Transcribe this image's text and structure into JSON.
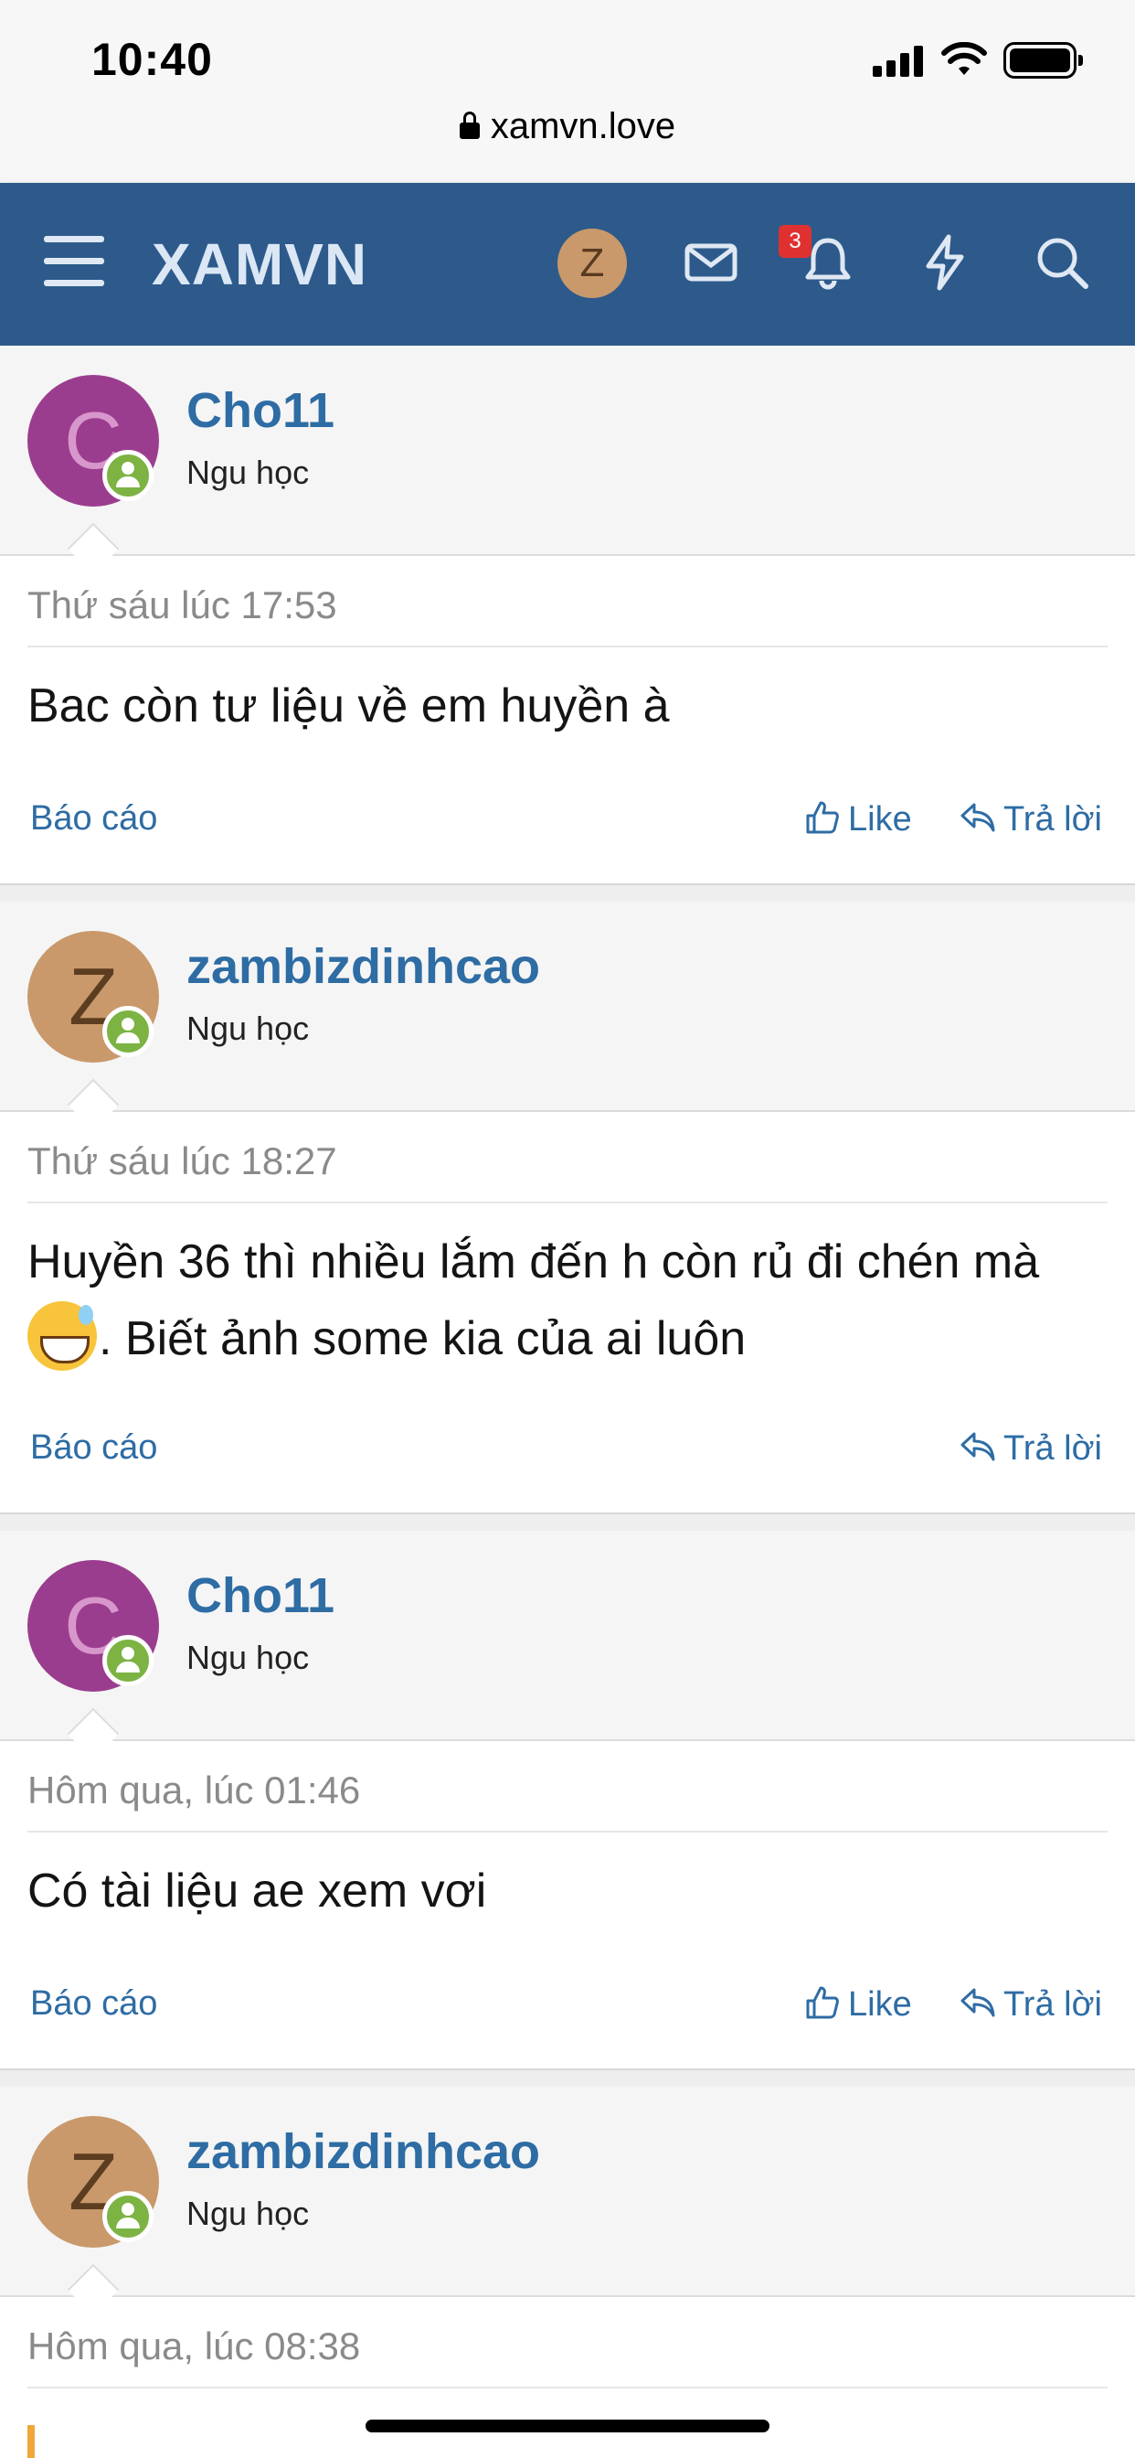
{
  "status_bar": {
    "time": "10:40",
    "url": "xamvn.love"
  },
  "nav": {
    "logo": "XAMVN",
    "avatar_letter": "Z",
    "notification_count": "3"
  },
  "posts": [
    {
      "username": "Cho11",
      "avatar_letter": "C",
      "user_title": "Ngu học",
      "date": "Thứ sáu lúc 17:53",
      "body": "Bac còn tư liệu về em huyền à",
      "report": "Báo cáo",
      "like": "Like",
      "reply": "Trả lời"
    },
    {
      "username": "zambizdinhcao",
      "avatar_letter": "Z",
      "user_title": "Ngu học",
      "date": "Thứ sáu lúc 18:27",
      "body_part1": "Huyền 36 thì nhiều lắm đến h còn rủ đi chén mà",
      "body_part2": ". Biết ảnh some kia của ai luôn",
      "report": "Báo cáo",
      "reply": "Trả lời"
    },
    {
      "username": "Cho11",
      "avatar_letter": "C",
      "user_title": "Ngu học",
      "date": "Hôm qua, lúc 01:46",
      "body": "Có tài liệu ae xem vơi",
      "report": "Báo cáo",
      "like": "Like",
      "reply": "Trả lời"
    },
    {
      "username": "zambizdinhcao",
      "avatar_letter": "Z",
      "user_title": "Ngu học",
      "date": "Hôm qua, lúc 08:38"
    }
  ],
  "icons": {
    "menu": "hamburger-icon",
    "mail": "mail-icon",
    "bell": "bell-icon",
    "bolt": "lightning-icon",
    "search": "search-icon",
    "like": "thumbs-up-icon",
    "reply": "reply-icon"
  }
}
